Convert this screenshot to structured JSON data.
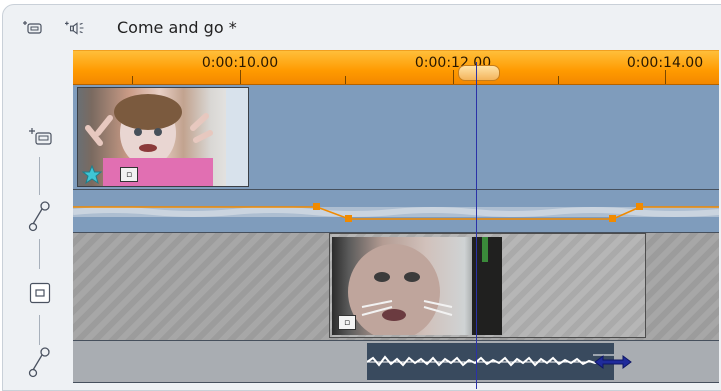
{
  "header": {
    "title": "Come and go *",
    "video_track_icon": "video-track-icon",
    "audio_track_icon": "speaker-icon"
  },
  "ruler": {
    "labels": [
      "0:00:10.00",
      "0:00:12.00",
      "0:00:14.00"
    ]
  },
  "tracks": [
    {
      "name": "main-video",
      "icon": "video-track-icon"
    },
    {
      "name": "main-audio",
      "icon": "audio-pen-icon"
    },
    {
      "name": "overlay-video",
      "icon": "overlay-track-icon"
    },
    {
      "name": "overlay-audio",
      "icon": "audio-pen-icon"
    }
  ],
  "colors": {
    "ruler": "#ff9a00",
    "track_blue": "#7f9cbc",
    "playhead": "#2b32a8",
    "volume_line": "#f08a00"
  }
}
